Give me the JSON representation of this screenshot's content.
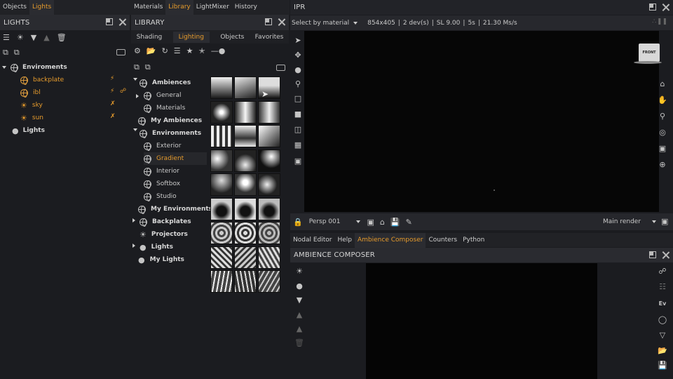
{
  "left_tabs": [
    {
      "label": "Objects"
    },
    {
      "label": "Lights",
      "active": true
    }
  ],
  "mid_tabs": [
    {
      "label": "Materials"
    },
    {
      "label": "Library",
      "active": true
    },
    {
      "label": "LightMixer"
    },
    {
      "label": "History"
    }
  ],
  "lights": {
    "title": "LIGHTS",
    "tree": [
      {
        "label": "Enviroments",
        "level": 0
      },
      {
        "label": "backplate",
        "level": 1
      },
      {
        "label": "ibl",
        "level": 1
      },
      {
        "label": "sky",
        "level": 1
      },
      {
        "label": "sun",
        "level": 1
      },
      {
        "label": "Lights",
        "level": 0
      }
    ]
  },
  "library": {
    "title": "LIBRARY",
    "tabs": [
      {
        "label": "Shading"
      },
      {
        "label": "Lighting",
        "active": true
      },
      {
        "label": "Objects"
      },
      {
        "label": "Favorites"
      }
    ],
    "tree": [
      {
        "label": "Ambiences"
      },
      {
        "label": "General"
      },
      {
        "label": "Materials"
      },
      {
        "label": "My Ambiences"
      },
      {
        "label": "Environments"
      },
      {
        "label": "Exterior"
      },
      {
        "label": "Gradient",
        "selected": true
      },
      {
        "label": "Interior"
      },
      {
        "label": "Softbox"
      },
      {
        "label": "Studio"
      },
      {
        "label": "My Environments"
      },
      {
        "label": "Backplates"
      },
      {
        "label": "Projectors"
      },
      {
        "label": "Lights"
      },
      {
        "label": "My Lights"
      }
    ]
  },
  "ipr": {
    "title": "IPR",
    "select_mode": "Select by material",
    "stats": [
      "854x405",
      "2 dev(s)",
      "SL 9.00",
      "5s",
      "21.30 Ms/s"
    ],
    "gizmo_label": "FRONT",
    "camera": "Persp 001",
    "render_target": "Main render"
  },
  "bottom_tabs": [
    {
      "label": "Nodal Editor"
    },
    {
      "label": "Help"
    },
    {
      "label": "Ambience Composer",
      "active": true
    },
    {
      "label": "Counters"
    },
    {
      "label": "Python"
    }
  ],
  "composer": {
    "title": "AMBIENCE COMPOSER",
    "ev_label": "Ev"
  },
  "colors": {
    "accent": "#e69b2c",
    "panel": "#1b1c20",
    "header": "#2a2b30"
  }
}
